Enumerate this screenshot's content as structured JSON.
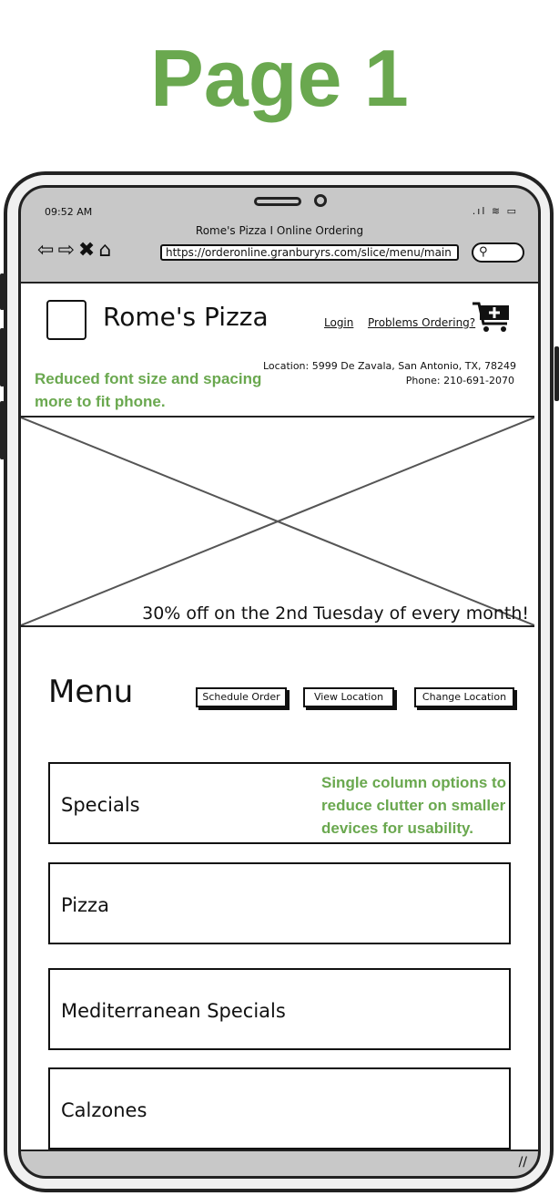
{
  "annotation": {
    "page_label": "Page 1",
    "note_header": "Reduced font size and spacing more to fit phone.",
    "note_menu": "Single column options to reduce clutter on smaller devices for usability."
  },
  "status_bar": {
    "time": "09:52 AM"
  },
  "browser": {
    "tab_title": "Rome's Pizza I Online Ordering",
    "url": "https://orderonline.granburyrs.com/slice/menu/main"
  },
  "header": {
    "site_name": "Rome's Pizza",
    "login": "Login",
    "problems": "Problems Ordering?",
    "location": "Location: 5999 De Zavala, San Antonio, TX, 78249",
    "phone": "Phone: 210-691-2070"
  },
  "hero": {
    "promo": "30% off on the 2nd Tuesday of every month!"
  },
  "menu": {
    "title": "Menu",
    "buttons": {
      "schedule": "Schedule Order",
      "view_location": "View Location",
      "change_location": "Change Location"
    },
    "items": [
      "Specials",
      "Pizza",
      "Mediterranean Specials",
      "Calzones"
    ]
  },
  "icons": {
    "back": "back-arrow-icon",
    "forward": "forward-arrow-icon",
    "close": "close-icon",
    "home": "home-icon",
    "search": "search-icon",
    "cart": "cart-icon"
  },
  "colors": {
    "annotation_green": "#6aa84f"
  }
}
